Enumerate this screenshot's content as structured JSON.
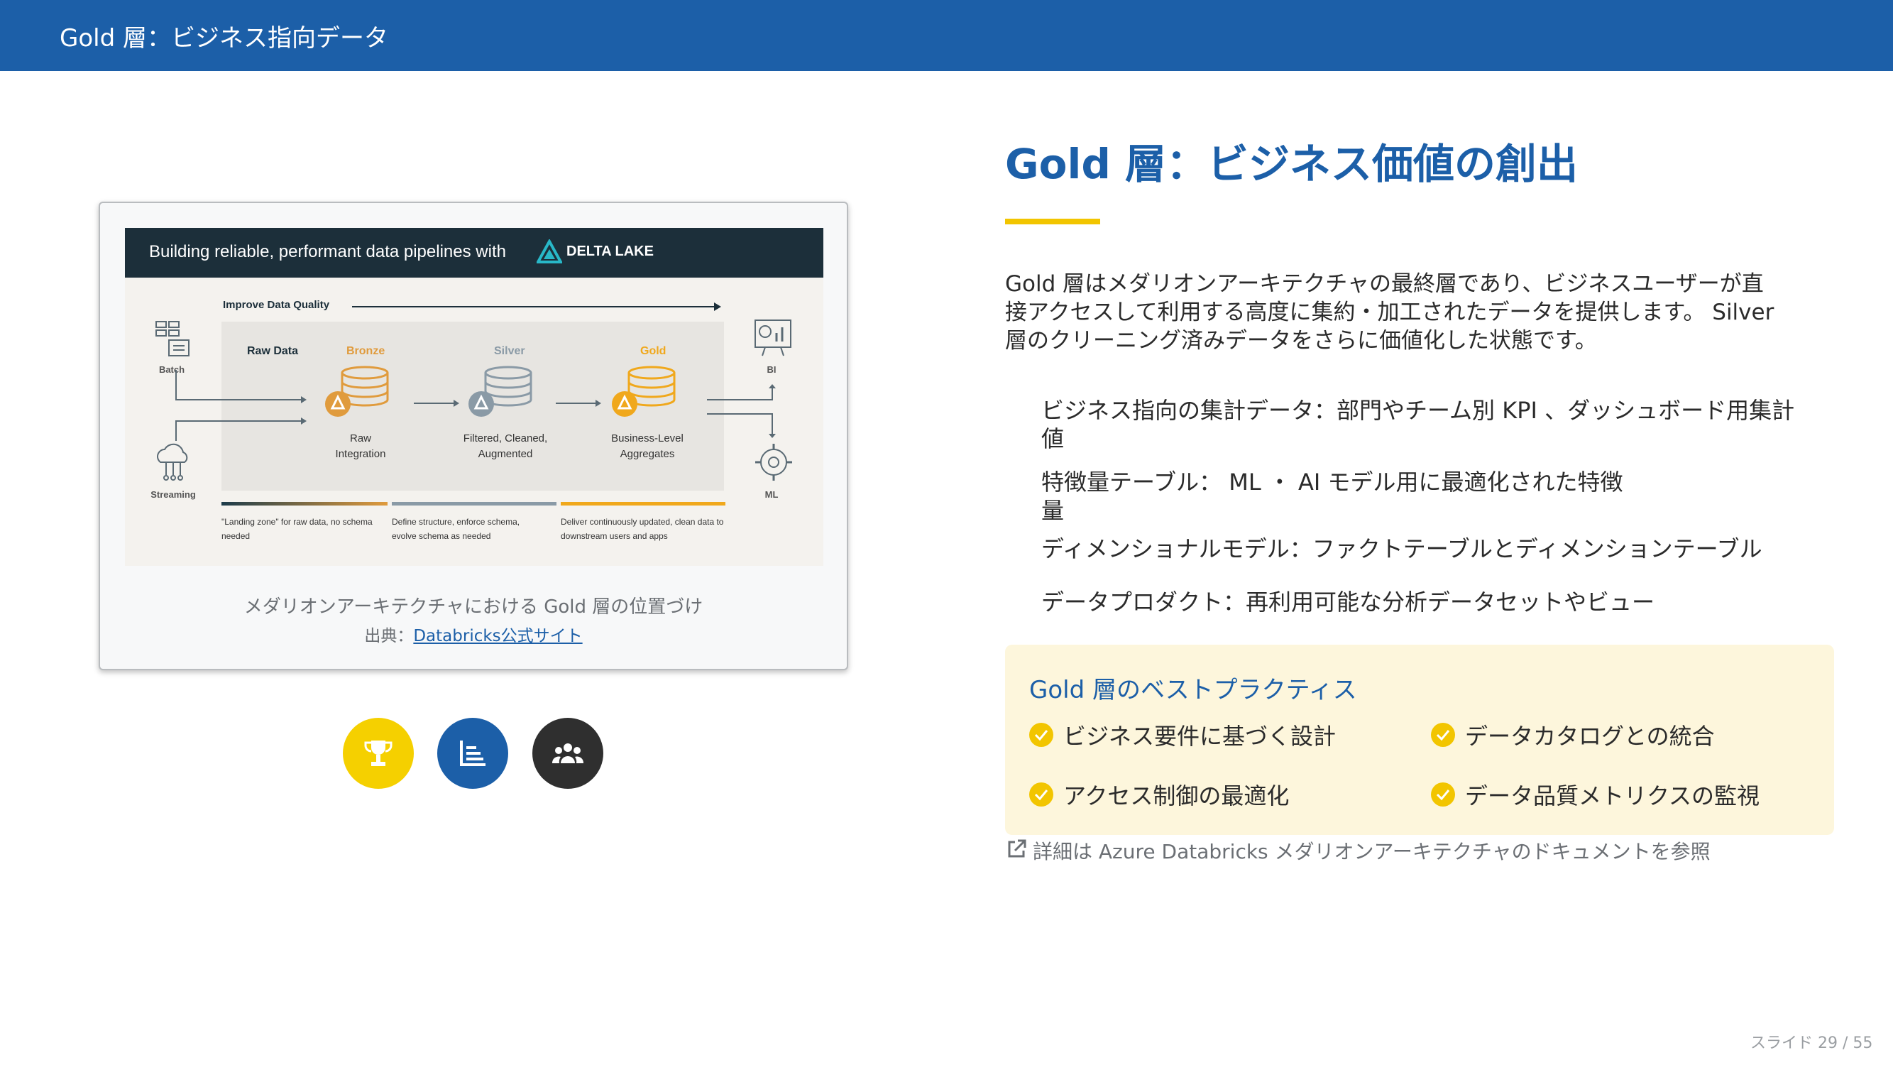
{
  "header": {
    "title": "Gold 層：ビジネス指向データ"
  },
  "figure": {
    "diagram": {
      "band_title": "Building reliable, performant data pipelines with",
      "brand": "DELTA LAKE",
      "improve_label": "Improve Data Quality",
      "raw_label": "Raw Data",
      "stages": [
        {
          "label": "Bronze",
          "sub": "Raw\nIntegration",
          "color": "#e09b3d"
        },
        {
          "label": "Silver",
          "sub": "Filtered, Cleaned,\nAugmented",
          "color": "#8a9aa6"
        },
        {
          "label": "Gold",
          "sub": "Business-Level\nAggregates",
          "color": "#f0a81c"
        }
      ],
      "inputs": [
        "Batch",
        "Streaming"
      ],
      "outputs": [
        "BI",
        "ML"
      ],
      "notes": [
        "\"Landing zone\" for raw data, no schema needed",
        "Define structure, enforce schema, evolve schema as needed",
        "Deliver continuously updated, clean data to downstream users and apps"
      ]
    },
    "caption": "メダリオンアーキテクチャにおける Gold 層の位置づけ",
    "source_prefix": "出典：",
    "source_link": "Databricks公式サイト"
  },
  "icons": [
    {
      "name": "trophy-icon",
      "color": "#f5d000"
    },
    {
      "name": "bar-chart-icon",
      "color": "#1c5fa8"
    },
    {
      "name": "users-icon",
      "color": "#2f2f2f"
    }
  ],
  "main": {
    "title": "Gold 層：ビジネス価値の創出",
    "intro_lines": [
      "Gold 層はメダリオンアーキテクチャの最終層であり、ビジネスユーザーが直",
      "接アクセスして利用する高度に集約・加工されたデータを提供します。 Silver",
      "層のクリーニング済みデータをさらに価値化した状態です。"
    ],
    "bullets": [
      [
        "ビジネス指向の集計データ：部門やチーム別 KPI 、ダッシュボード用集計",
        "値"
      ],
      [
        "特徴量テーブル： ML ・ AI モデル用に最適化された特徴",
        "量"
      ],
      [
        "ディメンショナルモデル：ファクトテーブルとディメンションテーブル"
      ],
      [
        "データプロダクト：再利用可能な分析データセットやビュー"
      ]
    ]
  },
  "practices": {
    "title": "Gold 層のベストプラクティス",
    "items": [
      "ビジネス要件に基づく設計",
      "データカタログとの統合",
      "アクセス制御の最適化",
      "データ品質メトリクスの監視"
    ]
  },
  "reference": "詳細は Azure Databricks メダリオンアーキテクチャのドキュメントを参照",
  "slide_number": "スライド 29 / 55",
  "colors": {
    "brand_blue": "#1c5fa8",
    "accent_yellow": "#f2c500"
  }
}
